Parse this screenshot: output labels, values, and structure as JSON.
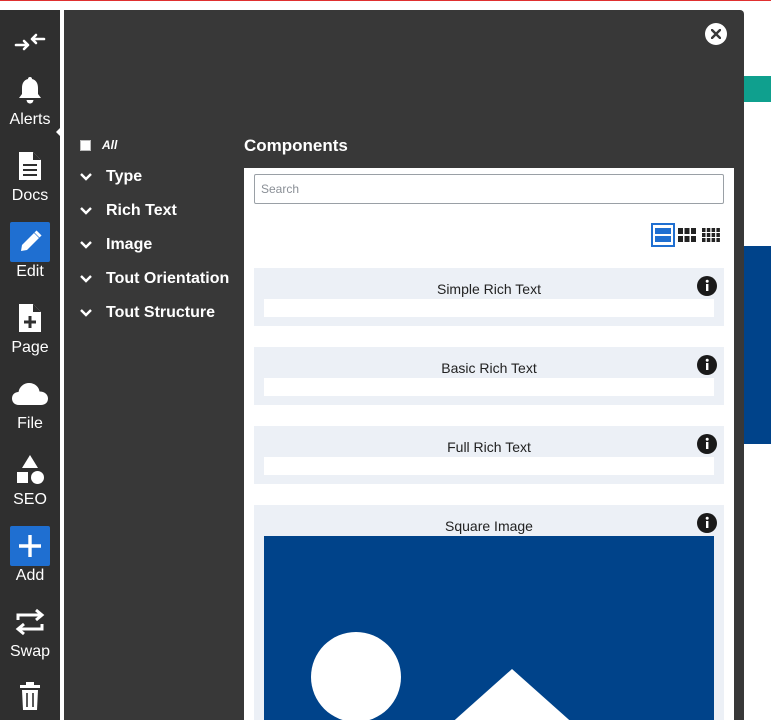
{
  "sidebar": {
    "items": [
      {
        "label": "",
        "icon": "collapse-arrows-icon"
      },
      {
        "label": "Alerts",
        "icon": "bell-icon"
      },
      {
        "label": "Docs",
        "icon": "document-icon"
      },
      {
        "label": "Edit",
        "icon": "pencil-icon",
        "active": true
      },
      {
        "label": "Page",
        "icon": "file-plus-icon"
      },
      {
        "label": "File",
        "icon": "cloud-icon"
      },
      {
        "label": "SEO",
        "icon": "shapes-icon"
      },
      {
        "label": "Add",
        "icon": "plus-icon",
        "active": true
      },
      {
        "label": "Swap",
        "icon": "swap-icon"
      },
      {
        "label": "",
        "icon": "trash-icon"
      }
    ]
  },
  "filters": {
    "all_label": "All",
    "items": [
      {
        "label": "Type"
      },
      {
        "label": "Rich Text"
      },
      {
        "label": "Image"
      },
      {
        "label": "Tout Orientation"
      },
      {
        "label": "Tout Structure"
      }
    ]
  },
  "components": {
    "title": "Components",
    "search_placeholder": "Search",
    "cards": [
      {
        "title": "Simple Rich Text"
      },
      {
        "title": "Basic Rich Text"
      },
      {
        "title": "Full Rich Text"
      },
      {
        "title": "Square Image"
      }
    ]
  },
  "colors": {
    "accent": "#1f6fd1",
    "panel": "#383838",
    "rail": "#2f2f2f",
    "card": "#ecf0f6",
    "image_blue": "#00438a"
  }
}
